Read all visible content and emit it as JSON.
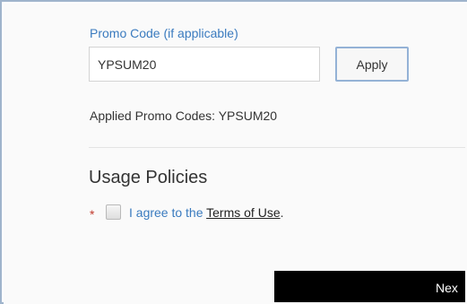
{
  "promo": {
    "label": "Promo Code (if applicable)",
    "value": "YPSUM20",
    "apply_label": "Apply",
    "applied_text": "Applied Promo Codes: YPSUM20"
  },
  "usage": {
    "title": "Usage Policies",
    "required_marker": "*",
    "agree_prefix": "I agree to the ",
    "terms_link": "Terms of Use",
    "agree_suffix": ".",
    "checked": false
  },
  "next": {
    "label_visible": "Nex"
  },
  "colors": {
    "label_blue": "#3a7bbf",
    "required_red": "#c0392b",
    "button_dark": "#000000"
  }
}
